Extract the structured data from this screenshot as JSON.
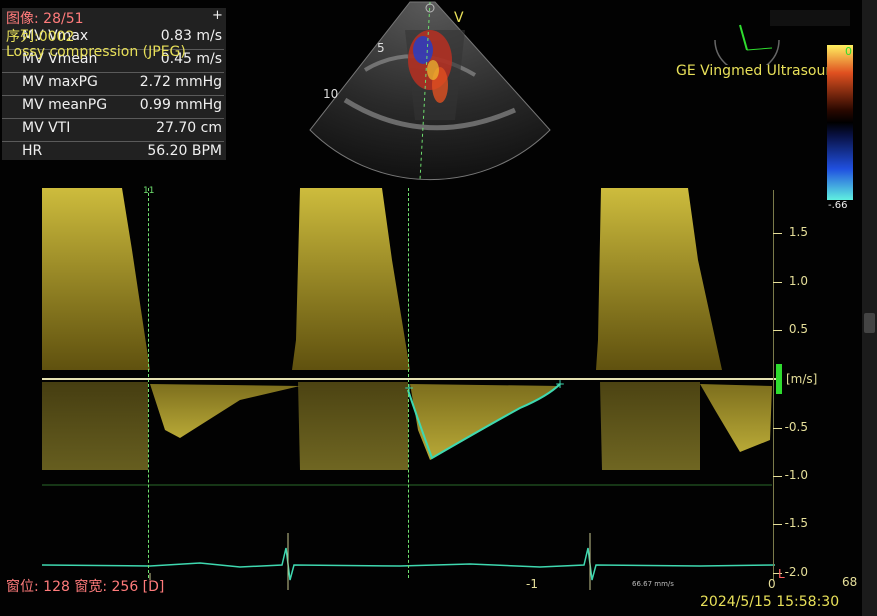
{
  "header": {
    "image_index": "图像: 28/51",
    "series": "序列:0002",
    "compression": "Lossy compression (JPEG)",
    "plus_symbol": "+",
    "vendor": "GE Vingmed Ultrasound",
    "mode_marker": "V"
  },
  "measurements": [
    {
      "name": "MV Vmax",
      "value": "0.83 m/s"
    },
    {
      "name": "MV Vmean",
      "value": "0.45 m/s"
    },
    {
      "name": "MV maxPG",
      "value": "2.72 mmHg"
    },
    {
      "name": "MV meanPG",
      "value": "0.99 mmHg"
    },
    {
      "name": "MV VTI",
      "value": "27.70 cm"
    },
    {
      "name": "HR",
      "value": "56.20 BPM"
    }
  ],
  "depth_marks": [
    "5",
    "10"
  ],
  "colorbar": {
    "top": "0",
    "bottom": "-.66"
  },
  "velocity_scale": {
    "unit": "[m/s]",
    "ticks": [
      "1.5",
      "1.0",
      "0.5",
      "-0.5",
      "-1.0",
      "-1.5",
      "-2.0"
    ]
  },
  "time_axis": {
    "tick": "-1",
    "zero": "0",
    "sweep": "66.67 mm/s"
  },
  "frame_rate": "68",
  "footer": {
    "window": "窗位: 128 窗宽: 256 [D]",
    "timestamp": "2024/5/15 15:58:30"
  },
  "colors": {
    "spectrum": "#d8c640",
    "trace": "#3fd8b0",
    "cursor": "#6fe06f",
    "label_red": "#ff7b7b",
    "label_yellow": "#e8e059"
  }
}
